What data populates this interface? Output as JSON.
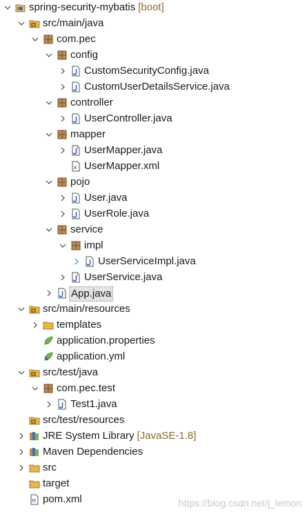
{
  "tree": [
    {
      "label": "spring-security-mybatis",
      "suffix": "[boot]",
      "level": 0,
      "toggle": "expanded",
      "icon": "project-icon"
    },
    {
      "label": "src/main/java",
      "level": 1,
      "toggle": "expanded",
      "icon": "source-folder-icon"
    },
    {
      "label": "com.pec",
      "level": 2,
      "toggle": "expanded",
      "icon": "package-icon"
    },
    {
      "label": "config",
      "level": 3,
      "toggle": "expanded",
      "icon": "package-icon"
    },
    {
      "label": "CustomSecurityConfig.java",
      "level": 4,
      "toggle": "collapsed",
      "icon": "java-file-icon"
    },
    {
      "label": "CustomUserDetailsService.java",
      "level": 4,
      "toggle": "collapsed",
      "icon": "java-file-icon"
    },
    {
      "label": "controller",
      "level": 3,
      "toggle": "expanded",
      "icon": "package-icon"
    },
    {
      "label": "UserController.java",
      "level": 4,
      "toggle": "collapsed",
      "icon": "java-file-icon"
    },
    {
      "label": "mapper",
      "level": 3,
      "toggle": "expanded",
      "icon": "package-icon"
    },
    {
      "label": "UserMapper.java",
      "level": 4,
      "toggle": "collapsed",
      "icon": "java-interface-icon"
    },
    {
      "label": "UserMapper.xml",
      "level": 4,
      "toggle": "none",
      "icon": "xml-file-icon"
    },
    {
      "label": "pojo",
      "level": 3,
      "toggle": "expanded",
      "icon": "package-icon"
    },
    {
      "label": "User.java",
      "level": 4,
      "toggle": "collapsed",
      "icon": "java-file-icon"
    },
    {
      "label": "UserRole.java",
      "level": 4,
      "toggle": "collapsed",
      "icon": "java-file-icon"
    },
    {
      "label": "service",
      "level": 3,
      "toggle": "expanded",
      "icon": "package-icon"
    },
    {
      "label": "impl",
      "level": 4,
      "toggle": "expanded",
      "icon": "package-icon"
    },
    {
      "label": "UserServiceImpl.java",
      "level": 5,
      "toggle": "collapsed-hover",
      "icon": "java-file-icon"
    },
    {
      "label": "UserService.java",
      "level": 4,
      "toggle": "collapsed",
      "icon": "java-interface-icon"
    },
    {
      "label": "App.java",
      "level": 3,
      "toggle": "collapsed",
      "icon": "java-file-icon",
      "selected": true
    },
    {
      "label": "src/main/resources",
      "level": 1,
      "toggle": "expanded",
      "icon": "source-folder-icon"
    },
    {
      "label": "templates",
      "level": 2,
      "toggle": "collapsed",
      "icon": "folder-icon"
    },
    {
      "label": "application.properties",
      "level": 2,
      "toggle": "none",
      "icon": "spring-leaf-icon"
    },
    {
      "label": "application.yml",
      "level": 2,
      "toggle": "none",
      "icon": "spring-yml-icon"
    },
    {
      "label": "src/test/java",
      "level": 1,
      "toggle": "expanded",
      "icon": "source-folder-icon"
    },
    {
      "label": "com.pec.test",
      "level": 2,
      "toggle": "expanded",
      "icon": "package-icon"
    },
    {
      "label": "Test1.java",
      "level": 3,
      "toggle": "collapsed",
      "icon": "java-file-icon"
    },
    {
      "label": "src/test/resources",
      "level": 1,
      "toggle": "none",
      "icon": "source-folder-icon"
    },
    {
      "label": "JRE System Library",
      "suffix": "[JavaSE-1.8]",
      "level": 1,
      "toggle": "collapsed",
      "icon": "library-icon"
    },
    {
      "label": "Maven Dependencies",
      "level": 1,
      "toggle": "collapsed",
      "icon": "library-icon"
    },
    {
      "label": "src",
      "level": 1,
      "toggle": "collapsed",
      "icon": "folder-icon"
    },
    {
      "label": "target",
      "level": 1,
      "toggle": "none",
      "icon": "folder-icon"
    },
    {
      "label": "pom.xml",
      "level": 1,
      "toggle": "none",
      "icon": "maven-file-icon"
    }
  ],
  "watermark": "https://blog.csdn.net/j_lemon",
  "colors": {
    "selection": "#e3e3e3",
    "suffix": "#8a6a2c",
    "package": "#8b5a2b",
    "folder": "#e8b64a",
    "java": "#2d5fa8"
  }
}
